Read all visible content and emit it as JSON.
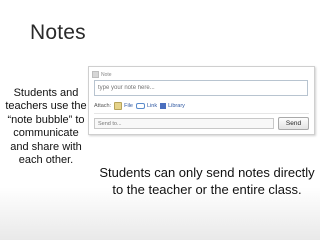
{
  "slide": {
    "title": "Notes",
    "side_text": "Students and teachers use the “note bubble” to communicate and share with each other.",
    "caption": "Students can only send notes directly to the teacher or the entire class."
  },
  "note_panel": {
    "header": "Note",
    "note_placeholder": "type your note here...",
    "attach_label": "Attach:",
    "attachments": [
      {
        "label": "File",
        "icon": "file-icon"
      },
      {
        "label": "Link",
        "icon": "link-icon"
      },
      {
        "label": "Library",
        "icon": "library-icon"
      }
    ],
    "send_to_placeholder": "Send to...",
    "send_label": "Send"
  }
}
